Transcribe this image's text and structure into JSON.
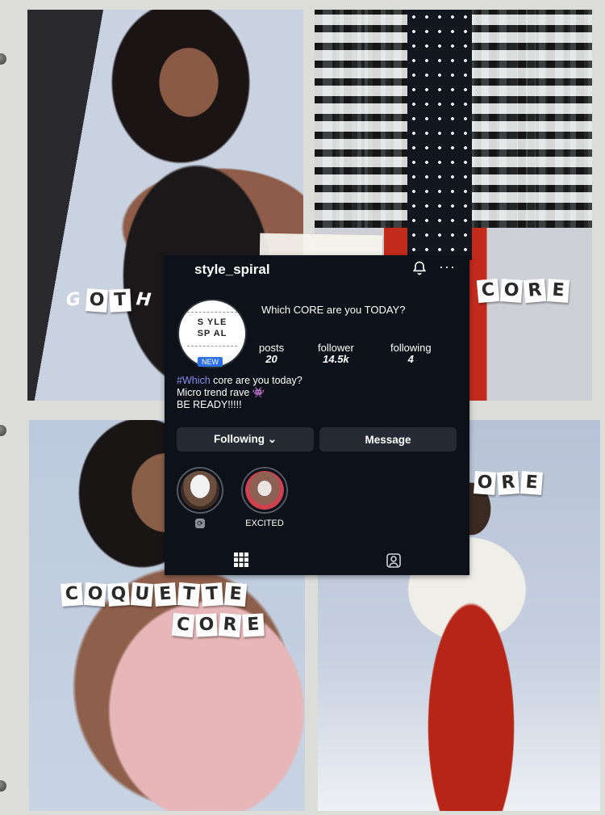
{
  "collage": {
    "goth_label": [
      "G",
      "O",
      "T",
      "H"
    ],
    "core_label_1": [
      "C",
      "O",
      "R",
      "E"
    ],
    "core_label_2": [
      "O",
      "R",
      "E"
    ],
    "coquette_label": [
      "C",
      "O",
      "Q",
      "U",
      "E",
      "T",
      "T",
      "E"
    ],
    "core_label_3": [
      "C",
      "O",
      "R",
      "E"
    ]
  },
  "profile": {
    "username": "style_spiral",
    "avatar_text": [
      "S YLE",
      "SP AL"
    ],
    "new_badge": "NEW",
    "tagline": "Which CORE are you TODAY?",
    "stats": [
      {
        "label": "posts",
        "value": "20"
      },
      {
        "label": "follower",
        "value": "14.5k"
      },
      {
        "label": "following",
        "value": "4"
      }
    ],
    "bio": {
      "hashtag": "#Which",
      "line1_rest": " core are you today?",
      "line2": "Micro trend rave 👾",
      "line3": "BE READY!!!!!"
    },
    "buttons": {
      "following": "Following ⌄",
      "message": "Message"
    },
    "highlights": [
      {
        "label": ""
      },
      {
        "label": "EXCITED"
      }
    ]
  },
  "colors": {
    "card_bg": "#0d1119",
    "button_bg": "#262a33",
    "hashtag": "#8d8cf0",
    "new_badge": "#2c6fe6"
  }
}
